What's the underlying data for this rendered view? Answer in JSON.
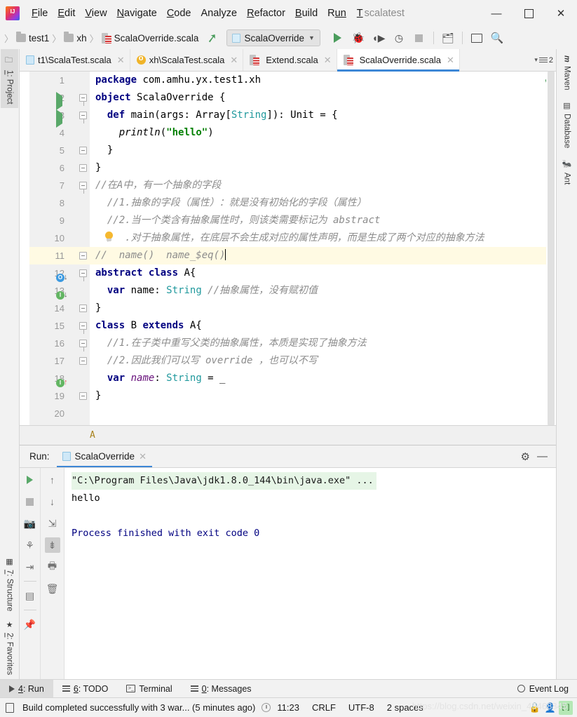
{
  "window": {
    "project_name": "scalatest",
    "project_tab_letter": "T",
    "minimize": "—",
    "maximize": "□",
    "close": "✕"
  },
  "menu": {
    "items": [
      {
        "mnemonic": "F",
        "rest": "ile"
      },
      {
        "mnemonic": "E",
        "rest": "dit"
      },
      {
        "mnemonic": "V",
        "rest": "iew"
      },
      {
        "mnemonic": "N",
        "rest": "avigate"
      },
      {
        "mnemonic": "C",
        "rest": "ode"
      },
      {
        "mnemonic": "A",
        "rest": "nalyze"
      },
      {
        "mnemonic": "R",
        "rest": "efactor"
      },
      {
        "mnemonic": "B",
        "rest": "uild"
      },
      {
        "mnemonic": "R",
        "rest": "un"
      }
    ]
  },
  "navbar": {
    "breadcrumbs": [
      "test1",
      "xh",
      "ScalaOverride.scala"
    ],
    "run_config": "ScalaOverride",
    "icons": [
      "run-icon",
      "debug-icon",
      "run-coverage-icon",
      "profile-icon",
      "stop-icon",
      "project-structure-icon",
      "console-icon",
      "search-everywhere-icon"
    ]
  },
  "tool_windows": {
    "left_top": [
      {
        "num": "1",
        "label": ": Project",
        "icon": "folder-icon"
      }
    ],
    "left_bottom": [
      {
        "num": "7",
        "label": ": Structure",
        "icon": "structure-icon"
      },
      {
        "num": "2",
        "label": ": Favorites",
        "icon": "star-icon"
      }
    ],
    "right": [
      {
        "label": "Maven",
        "icon": "maven-icon"
      },
      {
        "label": "Database",
        "icon": "database-icon"
      },
      {
        "label": "Ant",
        "icon": "ant-icon"
      }
    ]
  },
  "editor_tabs": {
    "tabs": [
      {
        "label": "t1\\ScalaTest.scala",
        "icon": "scala-object-icon",
        "active": false
      },
      {
        "label": "xh\\ScalaTest.scala",
        "icon": "scala-class-orange-icon",
        "active": false
      },
      {
        "label": "Extend.scala",
        "icon": "scala-file-icon",
        "active": false
      },
      {
        "label": "ScalaOverride.scala",
        "icon": "scala-file-icon",
        "active": true
      }
    ],
    "close_glyph": "✕",
    "tab_count_badge": "2"
  },
  "editor": {
    "breadcrumb": "A",
    "inspection_status": "ok-checkmark",
    "lines": [
      {
        "num": "1",
        "gutter": "",
        "fold": "",
        "highlight": false,
        "tokens": [
          {
            "t": "package",
            "c": "kw"
          },
          {
            "t": " com.amhu.yx.test1.xh",
            "c": "plain"
          }
        ]
      },
      {
        "num": "2",
        "gutter": "run",
        "fold": "open",
        "highlight": false,
        "tokens": [
          {
            "t": "object",
            "c": "kw"
          },
          {
            "t": " ScalaOverride {",
            "c": "plain"
          }
        ]
      },
      {
        "num": "3",
        "gutter": "run",
        "fold": "open",
        "highlight": false,
        "tokens": [
          {
            "t": "  ",
            "c": "plain"
          },
          {
            "t": "def",
            "c": "kw"
          },
          {
            "t": " main(args: Array[",
            "c": "plain"
          },
          {
            "t": "String",
            "c": "typ"
          },
          {
            "t": "]): Unit = {",
            "c": "plain"
          }
        ]
      },
      {
        "num": "4",
        "gutter": "",
        "fold": "",
        "highlight": false,
        "tokens": [
          {
            "t": "    ",
            "c": "plain"
          },
          {
            "t": "println",
            "c": "ital"
          },
          {
            "t": "(",
            "c": "plain"
          },
          {
            "t": "\"hello\"",
            "c": "str"
          },
          {
            "t": ")",
            "c": "plain"
          }
        ]
      },
      {
        "num": "5",
        "gutter": "",
        "fold": "close",
        "highlight": false,
        "tokens": [
          {
            "t": "  }",
            "c": "plain"
          }
        ]
      },
      {
        "num": "6",
        "gutter": "",
        "fold": "close",
        "highlight": false,
        "tokens": [
          {
            "t": "}",
            "c": "plain"
          }
        ]
      },
      {
        "num": "7",
        "gutter": "",
        "fold": "open",
        "highlight": false,
        "tokens": [
          {
            "t": "//在A中，有一个抽象的字段",
            "c": "cmt"
          }
        ]
      },
      {
        "num": "8",
        "gutter": "",
        "fold": "",
        "highlight": false,
        "tokens": [
          {
            "t": "  //1.抽象的字段（属性）：就是没有初始化的字段（属性）",
            "c": "cmt"
          }
        ]
      },
      {
        "num": "9",
        "gutter": "",
        "fold": "",
        "highlight": false,
        "tokens": [
          {
            "t": "  //2.当一个类含有抽象属性时，则该类需要标记为 abstract",
            "c": "cmt"
          }
        ]
      },
      {
        "num": "10",
        "gutter": "bulb",
        "fold": "",
        "highlight": false,
        "tokens": [
          {
            "t": "  /",
            "c": "cmt"
          },
          {
            "t": "  ",
            "c": "cmt"
          },
          {
            "t": ".对于抽象属性，在底层不会生成对应的属性声明，而是生成了两个对应的抽象方法",
            "c": "cmt"
          }
        ]
      },
      {
        "num": "11",
        "gutter": "",
        "fold": "close",
        "highlight": true,
        "tokens": [
          {
            "t": "//  name()  name_$eq()",
            "c": "cmt"
          }
        ]
      },
      {
        "num": "12",
        "gutter": "overridden",
        "fold": "open",
        "highlight": false,
        "tokens": [
          {
            "t": "abstract class",
            "c": "kw"
          },
          {
            "t": " A{",
            "c": "plain"
          }
        ]
      },
      {
        "num": "13",
        "gutter": "implemented",
        "fold": "",
        "highlight": false,
        "tokens": [
          {
            "t": "  ",
            "c": "plain"
          },
          {
            "t": "var",
            "c": "kw"
          },
          {
            "t": " name: ",
            "c": "plain"
          },
          {
            "t": "String",
            "c": "typ"
          },
          {
            "t": " //抽象属性，没有赋初值",
            "c": "cmt"
          }
        ]
      },
      {
        "num": "14",
        "gutter": "",
        "fold": "close",
        "highlight": false,
        "tokens": [
          {
            "t": "}",
            "c": "plain"
          }
        ]
      },
      {
        "num": "15",
        "gutter": "",
        "fold": "open",
        "highlight": false,
        "tokens": [
          {
            "t": "class",
            "c": "kw"
          },
          {
            "t": " B ",
            "c": "plain"
          },
          {
            "t": "extends",
            "c": "kw"
          },
          {
            "t": " A{",
            "c": "plain"
          }
        ]
      },
      {
        "num": "16",
        "gutter": "",
        "fold": "open",
        "highlight": false,
        "tokens": [
          {
            "t": "  //1.在子类中重写父类的抽象属性，本质是实现了抽象方法",
            "c": "cmt"
          }
        ]
      },
      {
        "num": "17",
        "gutter": "",
        "fold": "close",
        "highlight": false,
        "tokens": [
          {
            "t": "  //2.因此我们可以写 override ，也可以不写",
            "c": "cmt"
          }
        ]
      },
      {
        "num": "18",
        "gutter": "implements",
        "fold": "",
        "highlight": false,
        "tokens": [
          {
            "t": "  ",
            "c": "plain"
          },
          {
            "t": "var",
            "c": "kw"
          },
          {
            "t": " ",
            "c": "plain"
          },
          {
            "t": "name",
            "c": "purp"
          },
          {
            "t": ": ",
            "c": "plain"
          },
          {
            "t": "String",
            "c": "typ"
          },
          {
            "t": " = _",
            "c": "plain"
          }
        ]
      },
      {
        "num": "19",
        "gutter": "",
        "fold": "close",
        "highlight": false,
        "tokens": [
          {
            "t": "}",
            "c": "plain"
          }
        ]
      },
      {
        "num": "20",
        "gutter": "",
        "fold": "",
        "highlight": false,
        "tokens": []
      }
    ]
  },
  "run_panel": {
    "label": "Run:",
    "tab_title": "ScalaOverride",
    "close_glyph": "✕",
    "gear_icon": "settings-gear-icon",
    "minimize_icon": "hide-icon",
    "left_tools": [
      "rerun-icon",
      "stop-icon",
      "camera-icon",
      "thread-dump-icon",
      "export-icon",
      "layout-icon",
      "pin-icon"
    ],
    "right_tools": [
      "up-arrow-icon",
      "down-arrow-icon",
      "soft-wrap-icon",
      "scroll-to-end-icon",
      "print-icon",
      "trash-icon"
    ],
    "console": [
      {
        "text": "\"C:\\Program Files\\Java\\jdk1.8.0_144\\bin\\java.exe\" ...",
        "style": "cmd"
      },
      {
        "text": "hello",
        "style": "plain"
      },
      {
        "text": "",
        "style": "plain"
      },
      {
        "text": "Process finished with exit code 0",
        "style": "blue"
      }
    ]
  },
  "bottom_bar": {
    "items": [
      {
        "num": "4",
        "label": ": Run",
        "icon": "run-triangle-icon",
        "selected": true
      },
      {
        "num": "6",
        "label": ": TODO",
        "icon": "todo-icon",
        "selected": false
      },
      {
        "num": "",
        "label": "Terminal",
        "icon": "terminal-icon",
        "selected": false
      },
      {
        "num": "0",
        "label": ": Messages",
        "icon": "messages-icon",
        "selected": false
      }
    ],
    "event_log": "Event Log"
  },
  "status_bar": {
    "message": "Build completed successfully with 3 war... (5 minutes ago)",
    "time": "11:23",
    "line_separator": "CRLF",
    "encoding": "UTF-8",
    "indent": "2 spaces",
    "icons": [
      "lock-icon",
      "inspector-icon",
      "git-branch-icon"
    ],
    "watermark": "https://blog.csdn.net/weixin_45468845"
  }
}
